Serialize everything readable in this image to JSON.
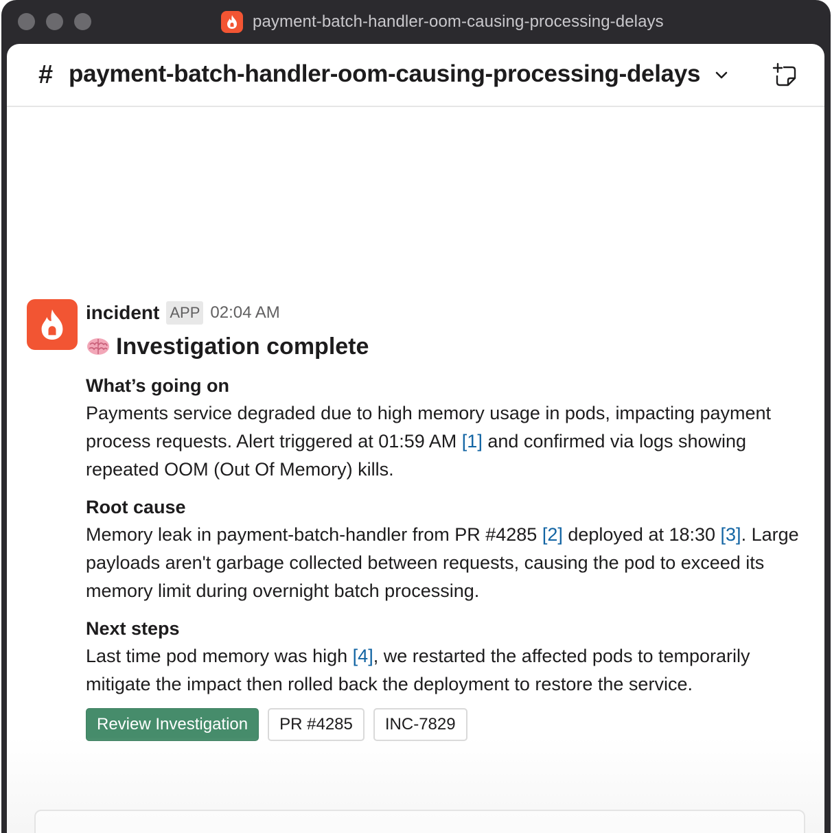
{
  "window": {
    "title": "payment-batch-handler-oom-causing-processing-delays"
  },
  "channel": {
    "hash": "#",
    "name": "payment-batch-handler-oom-causing-processing-delays"
  },
  "message": {
    "sender": "incident",
    "badge": "APP",
    "time": "02:04 AM",
    "heading": "Investigation complete",
    "sections": [
      {
        "title": "What’s going on",
        "text_1": "Payments service degraded due to high memory usage in pods, impacting payment process requests. Alert triggered at 01:59 AM ",
        "ref_1": "[1]",
        "text_2": " and confirmed via logs showing repeated OOM (Out Of Memory) kills."
      },
      {
        "title": "Root cause",
        "text_1": "Memory leak in payment-batch-handler from PR #4285 ",
        "ref_1": "[2]",
        "text_2": " deployed at 18:30 ",
        "ref_2": "[3]",
        "text_3": ". Large payloads aren't garbage collected between requests, causing the pod to exceed its memory limit during overnight batch processing."
      },
      {
        "title": "Next steps",
        "text_1": "Last time pod memory was high ",
        "ref_1": "[4]",
        "text_2": ", we restarted the affected pods to temporarily mitigate the impact then rolled back the deployment to restore the service."
      }
    ],
    "buttons": {
      "review": "Review Investigation",
      "pr": "PR #4285",
      "inc": "INC-7829"
    }
  },
  "colors": {
    "brand": "#f25533",
    "primary_button": "#468c6b",
    "link": "#1264a3"
  },
  "icons": {
    "app_logo": "flame-icon",
    "header_dropdown": "chevron-down-icon",
    "canvas": "new-canvas-icon",
    "heading_emoji": "brain-emoji"
  }
}
